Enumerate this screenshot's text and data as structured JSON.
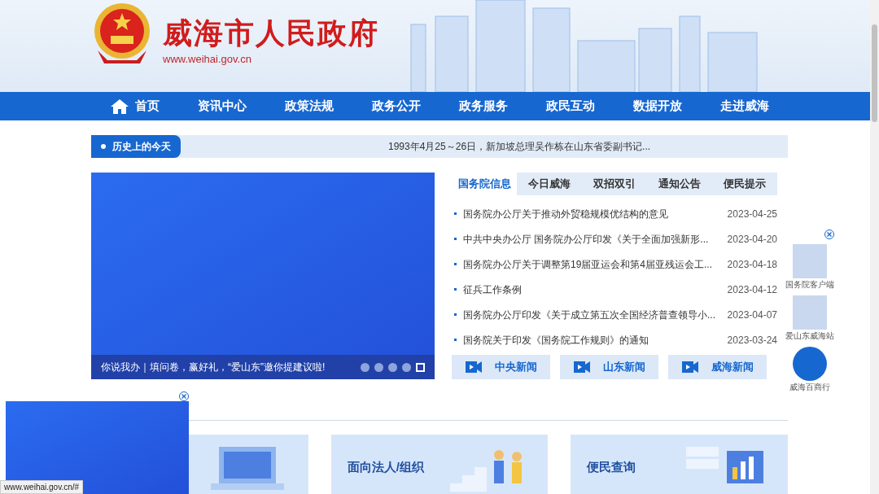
{
  "header": {
    "title": "威海市人民政府",
    "url": "www.weihai.gov.cn"
  },
  "nav": [
    {
      "label": "首页",
      "kind": "home"
    },
    {
      "label": "资讯中心",
      "kind": "text"
    },
    {
      "label": "政策法规",
      "kind": "text"
    },
    {
      "label": "政务公开",
      "kind": "text"
    },
    {
      "label": "政务服务",
      "kind": "text"
    },
    {
      "label": "政民互动",
      "kind": "text"
    },
    {
      "label": "数据开放",
      "kind": "text"
    },
    {
      "label": "走进威海",
      "kind": "text"
    }
  ],
  "history": {
    "label": "历史上的今天",
    "text": "1993年4月25～26日，新加坡总理吴作栋在山东省委副书记..."
  },
  "carousel": {
    "caption": "你说我办｜填问卷，赢好礼，“爱山东”邀你提建议啦!",
    "dots": [
      {
        "selected": false
      },
      {
        "selected": false
      },
      {
        "selected": false
      },
      {
        "selected": false
      },
      {
        "selected": true
      }
    ]
  },
  "news": {
    "tabs": [
      {
        "label": "国务院信息",
        "selected": true
      },
      {
        "label": "今日威海",
        "selected": false
      },
      {
        "label": "双招双引",
        "selected": false
      },
      {
        "label": "通知公告",
        "selected": false
      },
      {
        "label": "便民提示",
        "selected": false
      }
    ],
    "items": [
      {
        "title": "国务院办公厅关于推动外贸稳规模优结构的意见",
        "date": "2023-04-25"
      },
      {
        "title": "中共中央办公厅 国务院办公厅印发《关于全面加强新形...",
        "date": "2023-04-20"
      },
      {
        "title": "国务院办公厅关于调整第19届亚运会和第4届亚残运会工...",
        "date": "2023-04-18"
      },
      {
        "title": "征兵工作条例",
        "date": "2023-04-12"
      },
      {
        "title": "国务院办公厅印发《关于成立第五次全国经济普查领导小...",
        "date": "2023-04-07"
      },
      {
        "title": "国务院关于印发《国务院工作规则》的通知",
        "date": "2023-03-24"
      }
    ]
  },
  "news_buttons": [
    "中央新闻",
    "山东新闻",
    "威海新闻"
  ],
  "service_cards": [
    {
      "kind": "computer"
    },
    {
      "kind": "people",
      "label": "面向法人/组织"
    },
    {
      "kind": "chart",
      "label": "便民查询"
    }
  ],
  "side_links": [
    {
      "label": "国务院客户端"
    },
    {
      "label": "爱山东威海站"
    },
    {
      "label": "威海百商行"
    }
  ],
  "status_bar": "www.weihai.gov.cn/#"
}
